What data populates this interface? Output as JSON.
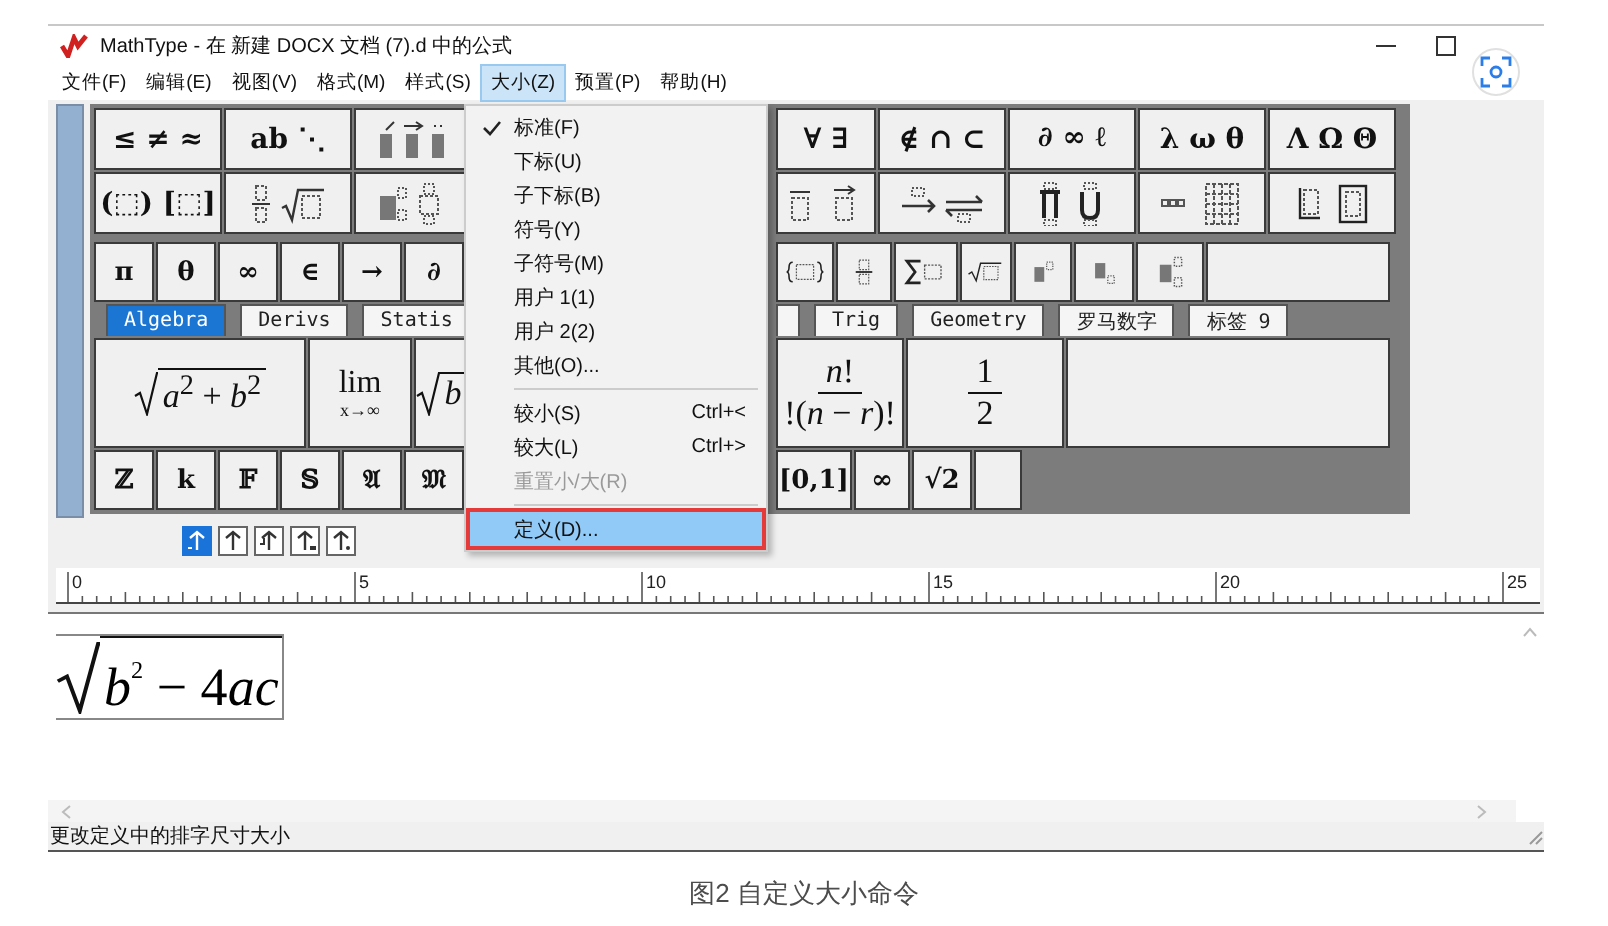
{
  "window": {
    "title": "MathType - 在 新建 DOCX 文档 (7).d 中的公式"
  },
  "menu_bar": [
    {
      "label": "文件(F)",
      "selected": false
    },
    {
      "label": "编辑(E)",
      "selected": false
    },
    {
      "label": "视图(V)",
      "selected": false
    },
    {
      "label": "格式(M)",
      "selected": false
    },
    {
      "label": "样式(S)",
      "selected": false
    },
    {
      "label": "大小(Z)",
      "selected": true
    },
    {
      "label": "预置(P)",
      "selected": false
    },
    {
      "label": "帮助(H)",
      "selected": false
    }
  ],
  "size_menu": [
    {
      "kind": "item",
      "label": "标准(F)",
      "checked": true,
      "selected": false,
      "disabled": false
    },
    {
      "kind": "item",
      "label": "下标(U)",
      "checked": false,
      "selected": false,
      "disabled": false
    },
    {
      "kind": "item",
      "label": "子下标(B)",
      "checked": false,
      "selected": false,
      "disabled": false
    },
    {
      "kind": "item",
      "label": "符号(Y)",
      "checked": false,
      "selected": false,
      "disabled": false
    },
    {
      "kind": "item",
      "label": "子符号(M)",
      "checked": false,
      "selected": false,
      "disabled": false
    },
    {
      "kind": "item",
      "label": "用户 1(1)",
      "checked": false,
      "selected": false,
      "disabled": false
    },
    {
      "kind": "item",
      "label": "用户 2(2)",
      "checked": false,
      "selected": false,
      "disabled": false
    },
    {
      "kind": "item",
      "label": "其他(O)...",
      "checked": false,
      "selected": false,
      "disabled": false
    },
    {
      "kind": "separator"
    },
    {
      "kind": "item",
      "label": "较小(S)",
      "shortcut": "Ctrl+<",
      "checked": false,
      "selected": false,
      "disabled": false
    },
    {
      "kind": "item",
      "label": "较大(L)",
      "shortcut": "Ctrl+>",
      "checked": false,
      "selected": false,
      "disabled": false
    },
    {
      "kind": "item",
      "label": "重置小/大(R)",
      "checked": false,
      "selected": false,
      "disabled": true
    },
    {
      "kind": "separator"
    },
    {
      "kind": "item",
      "label": "定义(D)...",
      "checked": false,
      "selected": true,
      "disabled": false,
      "marked": true
    }
  ],
  "palette": [
    {
      "kind": "symbols",
      "left": [
        {
          "kind": "text",
          "label": "≤ ≠ ≈"
        },
        {
          "kind": "text",
          "label": "ab ⋱"
        },
        {
          "kind": "icon"
        }
      ],
      "right": [
        {
          "kind": "text",
          "label": "∀ ∃"
        },
        {
          "kind": "text",
          "label": "∉ ∩ ⊂"
        },
        {
          "kind": "text",
          "label": "∂ ∞ ℓ"
        },
        {
          "kind": "text",
          "label": "λ ω θ"
        },
        {
          "kind": "text",
          "label": "Λ Ω Θ"
        }
      ]
    },
    {
      "kind": "symbols",
      "left": [
        {
          "kind": "text",
          "label": "(⬚) [⬚]"
        },
        {
          "kind": "icon"
        },
        {
          "kind": "icon"
        }
      ],
      "right": [
        {
          "kind": "icon"
        },
        {
          "kind": "icon"
        },
        {
          "kind": "icon"
        },
        {
          "kind": "icon"
        },
        {
          "kind": "icon"
        }
      ]
    },
    {
      "kind": "small",
      "left": [
        {
          "kind": "text",
          "label": "π"
        },
        {
          "kind": "text",
          "label": "θ"
        },
        {
          "kind": "text",
          "label": "∞"
        },
        {
          "kind": "text",
          "label": "∈"
        },
        {
          "kind": "text",
          "label": "→"
        },
        {
          "kind": "text",
          "label": "∂"
        }
      ],
      "right": [
        {
          "kind": "icon"
        },
        {
          "kind": "icon"
        },
        {
          "kind": "icon"
        },
        {
          "kind": "icon"
        },
        {
          "kind": "icon"
        },
        {
          "kind": "icon"
        },
        {
          "kind": "icon"
        },
        {
          "kind": "empty"
        }
      ]
    },
    {
      "kind": "tabs",
      "left": [
        {
          "label": "Algebra",
          "selected": true
        },
        {
          "label": "Derivs",
          "selected": false
        },
        {
          "label": "Statis",
          "selected": false
        }
      ],
      "right": [
        {
          "selected": false
        },
        {
          "label": "Trig",
          "selected": false
        },
        {
          "label": "Geometry",
          "selected": false
        },
        {
          "label": "罗马数字",
          "selected": false
        },
        {
          "label": "标签 9",
          "selected": false
        }
      ]
    },
    {
      "kind": "templates",
      "left": [
        {
          "kind": "sqrt",
          "radicand": "*a*$^{2}$ + *b*$^{2}$"
        },
        {
          "kind": "lim",
          "top": "lim",
          "sub": "x→∞"
        },
        {
          "kind": "sqrt",
          "radicand": "*b*"
        }
      ],
      "right": [
        {
          "kind": "frac",
          "num": "*n*!",
          "den": "!(*n* − *r*)!"
        },
        {
          "kind": "frac",
          "num": "1",
          "den": "2"
        },
        {
          "kind": "empty"
        }
      ]
    },
    {
      "kind": "small",
      "left": [
        {
          "kind": "text",
          "label": "ℤ"
        },
        {
          "kind": "text",
          "label": "k"
        },
        {
          "kind": "text",
          "label": "𝔽"
        },
        {
          "kind": "text",
          "label": "𝕊"
        },
        {
          "kind": "text",
          "label": "𝔄"
        },
        {
          "kind": "text",
          "label": "𝔐"
        }
      ],
      "right": [
        {
          "kind": "text",
          "label": "[0,1]"
        },
        {
          "kind": "text",
          "label": "∞"
        },
        {
          "kind": "text",
          "label": "√2"
        },
        {
          "kind": "empty"
        }
      ]
    }
  ],
  "nudge_buttons": [
    {
      "selected": true
    },
    {
      "selected": false
    },
    {
      "selected": false
    },
    {
      "selected": false
    },
    {
      "selected": false
    }
  ],
  "ruler": {
    "labels": [
      "0",
      "5",
      "10",
      "15",
      "20",
      "25"
    ]
  },
  "equation": {
    "kind": "sqrt",
    "radicand": [
      {
        "kind": "italic",
        "text": "b"
      },
      {
        "kind": "sup",
        "text": "2"
      },
      {
        "kind": "plain",
        "text": " − 4"
      },
      {
        "kind": "italic",
        "text": "ac"
      }
    ]
  },
  "status_bar": "更改定义中的排字尺寸大小",
  "caption": "图2 自定义大小命令"
}
